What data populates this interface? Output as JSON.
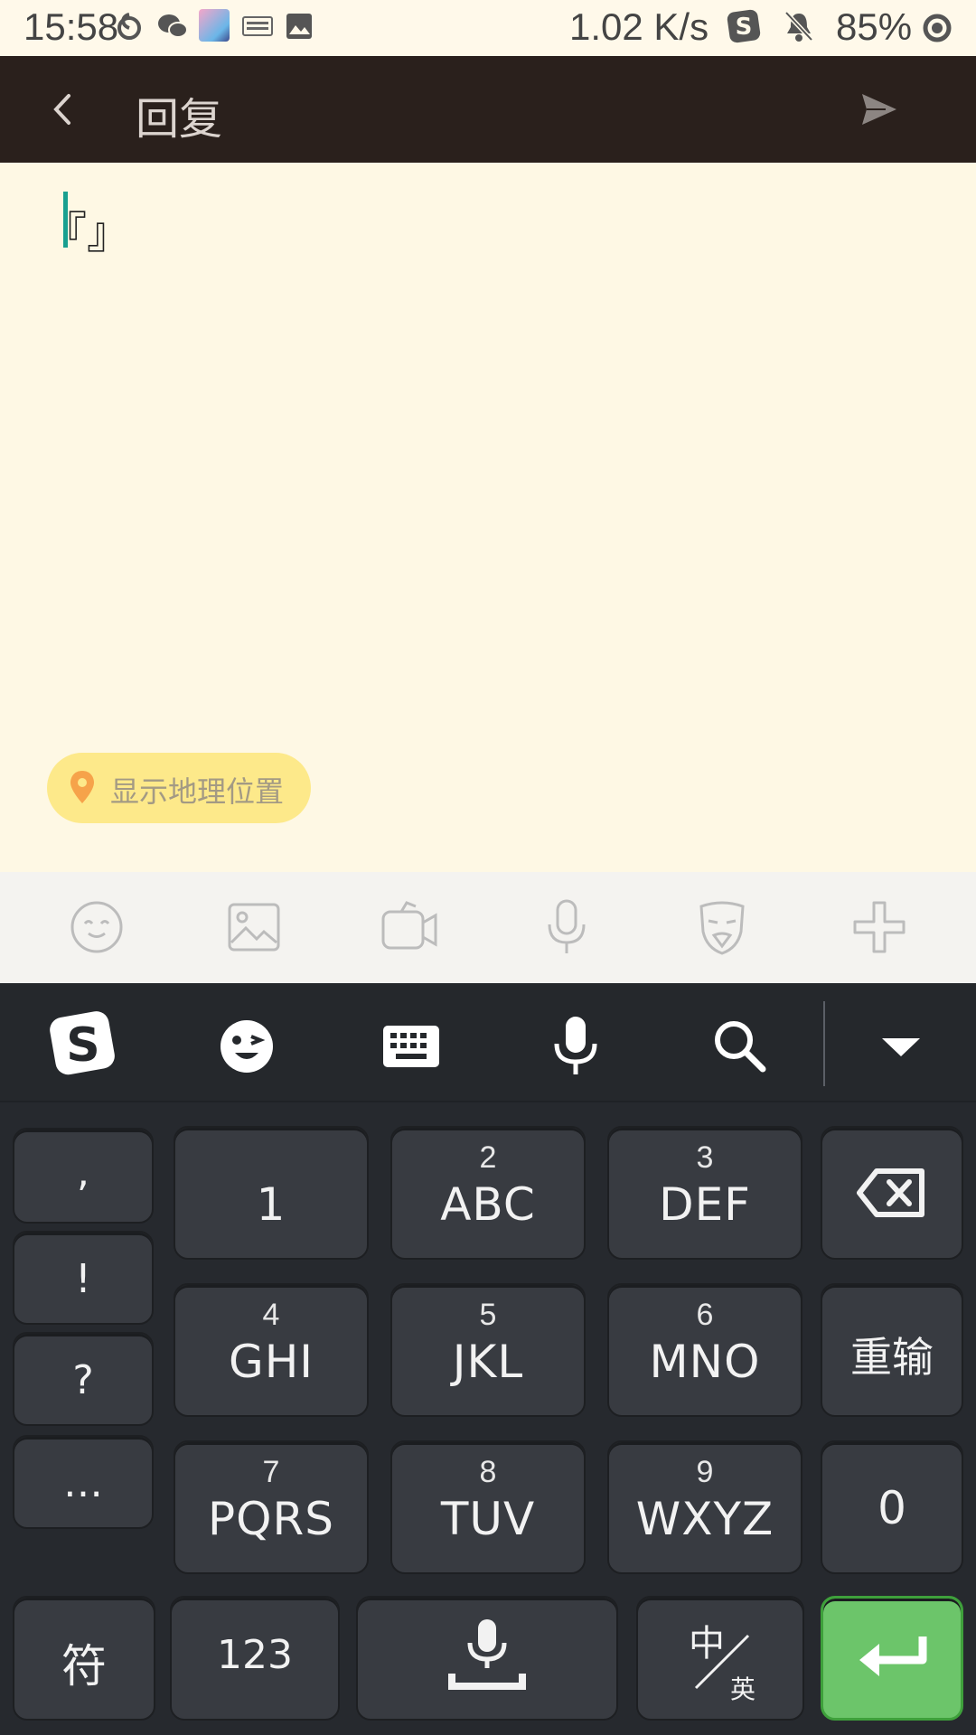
{
  "status_bar": {
    "time": "15:58",
    "network_speed": "1.02 K/s",
    "battery": "85%",
    "icons": [
      "netease-music-icon",
      "wechat-icon",
      "avatar-notification-icon",
      "keyboard-notification-icon",
      "image-notification-icon",
      "sogou-icon",
      "mute-bell-icon",
      "battery-ring-icon"
    ]
  },
  "toolbar": {
    "back_icon": "chevron-left-icon",
    "title": "回复",
    "send_icon": "send-icon"
  },
  "editor": {
    "content": "『』"
  },
  "location_button": {
    "label": "显示地理位置",
    "icon": "location-pin-icon"
  },
  "attachment_bar": {
    "icons": [
      "emoji-face-icon",
      "image-icon",
      "video-icon",
      "microphone-icon",
      "mask-icon",
      "plus-icon"
    ]
  },
  "keyboard": {
    "toolbar_icons": [
      "sogou-logo-icon",
      "sticker-emoji-icon",
      "keyboard-icon",
      "voice-icon",
      "search-icon",
      "collapse-icon"
    ],
    "punctuation": [
      ",",
      "!",
      "?",
      "…"
    ],
    "keys": [
      {
        "num": "",
        "label": "1"
      },
      {
        "num": "2",
        "label": "ABC"
      },
      {
        "num": "3",
        "label": "DEF"
      },
      {
        "num": "4",
        "label": "GHI"
      },
      {
        "num": "5",
        "label": "JKL"
      },
      {
        "num": "6",
        "label": "MNO"
      },
      {
        "num": "7",
        "label": "PQRS"
      },
      {
        "num": "8",
        "label": "TUV"
      },
      {
        "num": "9",
        "label": "WXYZ"
      }
    ],
    "reset_label": "重输",
    "zero_label": "0",
    "symbol_label": "符",
    "numeric_label": "123",
    "lang_zh": "中",
    "lang_en": "英",
    "colors": {
      "enter": "#6cc56a",
      "key": "#383b41",
      "background": "#26292e"
    }
  }
}
